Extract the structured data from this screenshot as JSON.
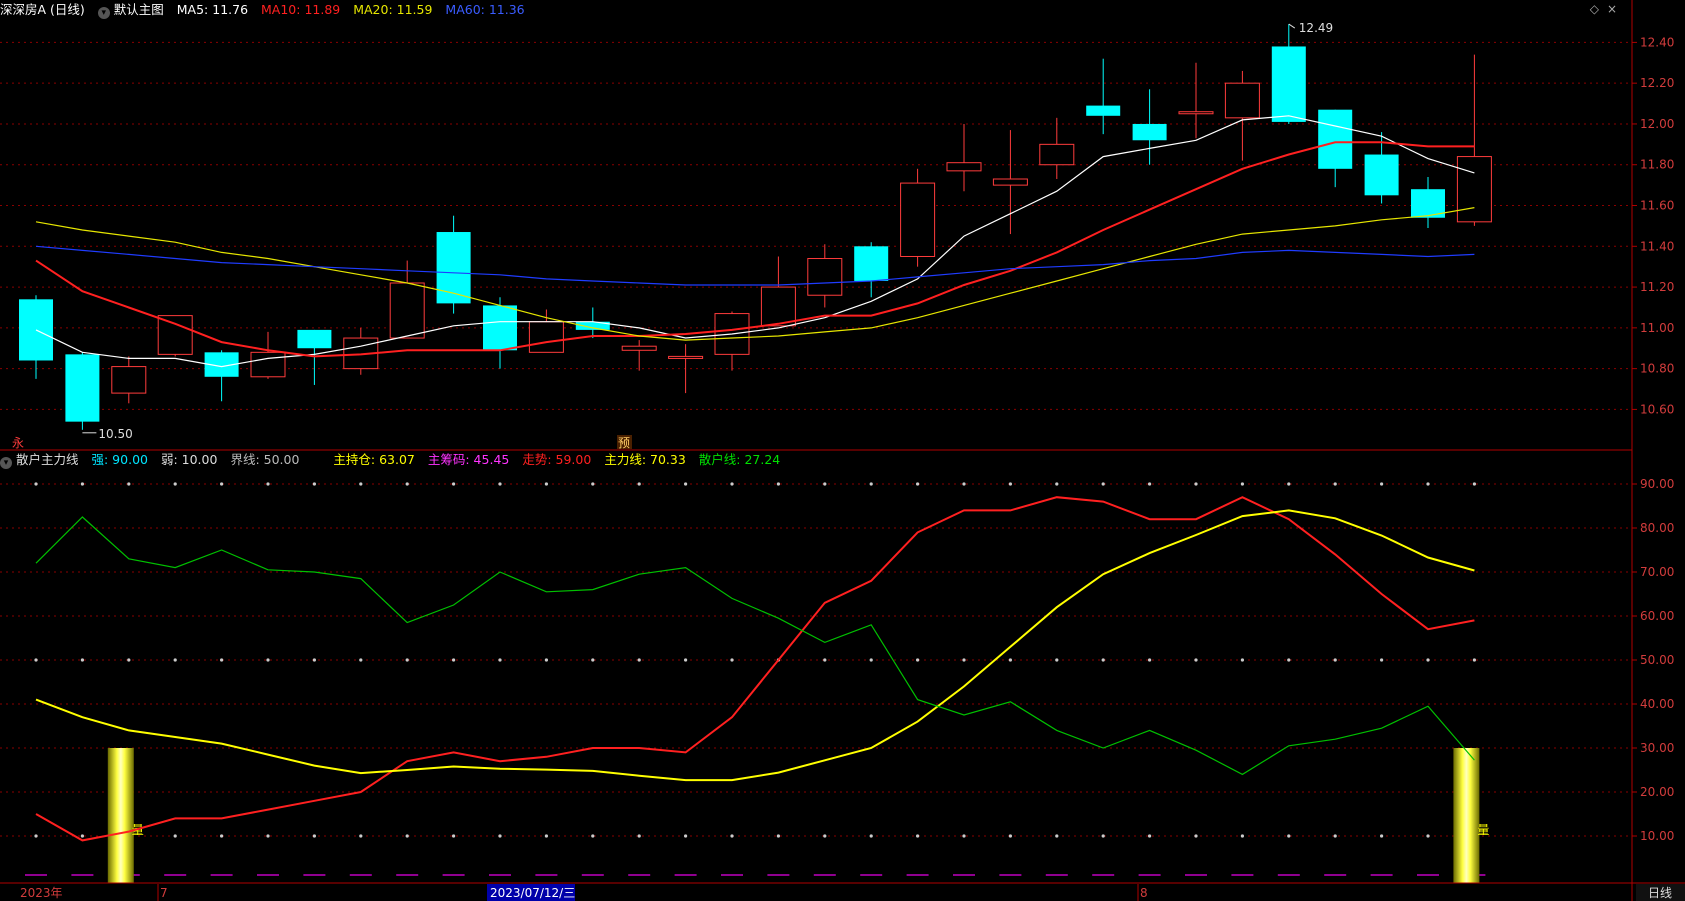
{
  "header": {
    "stock_name": "深深房A (日线)",
    "chart_mode": "默认主图",
    "ma5": "MA5: 11.76",
    "ma10": "MA10: 11.89",
    "ma20": "MA20: 11.59",
    "ma60": "MA60: 11.36"
  },
  "indicator_header": {
    "name": "散户主力线",
    "strong": "强: 90.00",
    "weak": "弱: 10.00",
    "boundary": "界线: 50.00",
    "main_hold": "主持仓: 63.07",
    "main_chips": "主筹码: 45.45",
    "trend": "走势: 59.00",
    "main_line": "主力线: 70.33",
    "retail_line": "散户线: 27.24"
  },
  "annotations": {
    "high_label": "12.49",
    "low_label": "10.50",
    "marker_left": "永",
    "marker_mid": "预",
    "bar_label": "量"
  },
  "x_axis": {
    "labels": [
      "2023年",
      "7",
      "2023/07/12/三",
      "8"
    ],
    "period": "日线"
  },
  "colors": {
    "up": "#ff3c3c",
    "down": "#00ffff",
    "ma5": "#ffffff",
    "ma10": "#ff2020",
    "ma20": "#e6e600",
    "ma60": "#1f3cff",
    "trend": "#ff2020",
    "main_line": "#ffff00",
    "retail_line": "#00c000",
    "grid": "#8a0000",
    "axis_text": "#d23c3c"
  },
  "chart_data": [
    {
      "type": "candlestick",
      "title": "深深房A (日线)",
      "ylim": [
        10.45,
        12.5
      ],
      "yticks": [
        10.6,
        10.8,
        11.0,
        11.2,
        11.4,
        11.6,
        11.8,
        12.0,
        12.2,
        12.4
      ],
      "ytick_labels": [
        "10.60",
        "10.80",
        "11.00",
        "11.20",
        "11.40",
        "11.60",
        "11.80",
        "12.00",
        "12.20",
        "12.40"
      ],
      "candles": [
        {
          "o": 11.14,
          "h": 11.16,
          "l": 10.75,
          "c": 10.84
        },
        {
          "o": 10.87,
          "h": 10.88,
          "l": 10.5,
          "c": 10.54
        },
        {
          "o": 10.68,
          "h": 10.86,
          "l": 10.63,
          "c": 10.81
        },
        {
          "o": 10.87,
          "h": 11.06,
          "l": 10.86,
          "c": 11.06
        },
        {
          "o": 10.88,
          "h": 10.89,
          "l": 10.64,
          "c": 10.76
        },
        {
          "o": 10.76,
          "h": 10.98,
          "l": 10.75,
          "c": 10.88
        },
        {
          "o": 10.99,
          "h": 10.99,
          "l": 10.72,
          "c": 10.9
        },
        {
          "o": 10.8,
          "h": 11.0,
          "l": 10.77,
          "c": 10.95
        },
        {
          "o": 10.95,
          "h": 11.33,
          "l": 10.95,
          "c": 11.22
        },
        {
          "o": 11.47,
          "h": 11.55,
          "l": 11.07,
          "c": 11.12
        },
        {
          "o": 11.11,
          "h": 11.15,
          "l": 10.8,
          "c": 10.89
        },
        {
          "o": 10.88,
          "h": 11.09,
          "l": 10.88,
          "c": 11.03
        },
        {
          "o": 11.03,
          "h": 11.1,
          "l": 10.95,
          "c": 10.99
        },
        {
          "o": 10.89,
          "h": 10.94,
          "l": 10.79,
          "c": 10.91
        },
        {
          "o": 10.85,
          "h": 10.92,
          "l": 10.68,
          "c": 10.86
        },
        {
          "o": 10.87,
          "h": 11.08,
          "l": 10.79,
          "c": 11.07
        },
        {
          "o": 11.01,
          "h": 11.35,
          "l": 11.01,
          "c": 11.2
        },
        {
          "o": 11.16,
          "h": 11.41,
          "l": 11.1,
          "c": 11.34
        },
        {
          "o": 11.4,
          "h": 11.42,
          "l": 11.15,
          "c": 11.23
        },
        {
          "o": 11.35,
          "h": 11.78,
          "l": 11.3,
          "c": 11.71
        },
        {
          "o": 11.77,
          "h": 12.0,
          "l": 11.67,
          "c": 11.81
        },
        {
          "o": 11.7,
          "h": 11.97,
          "l": 11.46,
          "c": 11.73
        },
        {
          "o": 11.8,
          "h": 12.03,
          "l": 11.73,
          "c": 11.9
        },
        {
          "o": 12.09,
          "h": 12.32,
          "l": 11.95,
          "c": 12.04
        },
        {
          "o": 12.0,
          "h": 12.17,
          "l": 11.8,
          "c": 11.92
        },
        {
          "o": 12.05,
          "h": 12.3,
          "l": 11.93,
          "c": 12.06
        },
        {
          "o": 12.03,
          "h": 12.26,
          "l": 11.82,
          "c": 12.2
        },
        {
          "o": 12.38,
          "h": 12.49,
          "l": 12.0,
          "c": 12.01
        },
        {
          "o": 12.07,
          "h": 12.07,
          "l": 11.69,
          "c": 11.78
        },
        {
          "o": 11.85,
          "h": 11.96,
          "l": 11.61,
          "c": 11.65
        },
        {
          "o": 11.68,
          "h": 11.74,
          "l": 11.49,
          "c": 11.54
        },
        {
          "o": 11.52,
          "h": 12.34,
          "l": 11.5,
          "c": 11.84
        }
      ],
      "series": [
        {
          "name": "MA5",
          "values": [
            10.99,
            10.88,
            10.85,
            10.85,
            10.81,
            10.85,
            10.87,
            10.91,
            10.96,
            11.01,
            11.03,
            11.03,
            11.03,
            11.0,
            10.95,
            10.97,
            11.0,
            11.05,
            11.13,
            11.24,
            11.45,
            11.56,
            11.67,
            11.84,
            11.88,
            11.92,
            12.02,
            12.04,
            11.99,
            11.94,
            11.83,
            11.76
          ]
        },
        {
          "name": "MA10",
          "values": [
            11.33,
            11.18,
            11.1,
            11.02,
            10.93,
            10.89,
            10.86,
            10.87,
            10.89,
            10.89,
            10.89,
            10.93,
            10.96,
            10.96,
            10.97,
            10.99,
            11.02,
            11.06,
            11.06,
            11.12,
            11.21,
            11.28,
            11.37,
            11.48,
            11.58,
            11.68,
            11.78,
            11.85,
            11.91,
            11.91,
            11.89,
            11.89
          ]
        },
        {
          "name": "MA20",
          "values": [
            11.52,
            11.48,
            11.45,
            11.42,
            11.37,
            11.34,
            11.3,
            11.26,
            11.22,
            11.17,
            11.11,
            11.05,
            11.0,
            10.96,
            10.94,
            10.95,
            10.96,
            10.98,
            11.0,
            11.05,
            11.11,
            11.17,
            11.23,
            11.29,
            11.35,
            11.41,
            11.46,
            11.48,
            11.5,
            11.53,
            11.55,
            11.59
          ]
        },
        {
          "name": "MA60",
          "values": [
            11.4,
            11.38,
            11.36,
            11.34,
            11.32,
            11.31,
            11.3,
            11.29,
            11.28,
            11.27,
            11.26,
            11.24,
            11.23,
            11.22,
            11.21,
            11.21,
            11.21,
            11.22,
            11.23,
            11.25,
            11.27,
            11.29,
            11.3,
            11.31,
            11.33,
            11.34,
            11.37,
            11.38,
            11.37,
            11.36,
            11.35,
            11.36
          ]
        }
      ]
    },
    {
      "type": "line",
      "title": "散户主力线",
      "ylim": [
        0,
        95
      ],
      "yticks": [
        10,
        20,
        30,
        40,
        50,
        60,
        70,
        80,
        90
      ],
      "ytick_labels": [
        "10.00",
        "20.00",
        "30.00",
        "40.00",
        "50.00",
        "60.00",
        "70.00",
        "80.00",
        "90.00"
      ],
      "reference_lines": [
        10,
        50,
        90
      ],
      "series": [
        {
          "name": "走势",
          "values": [
            15,
            9,
            11,
            14,
            14,
            16,
            18,
            20,
            27,
            29,
            27,
            28,
            30,
            30,
            29,
            37,
            50,
            63,
            68,
            79,
            84,
            84,
            87,
            86,
            82,
            82,
            87,
            82,
            74,
            65,
            57,
            59
          ]
        },
        {
          "name": "主力线",
          "values": [
            41,
            37,
            34,
            32.5,
            31,
            28.5,
            26,
            24.3,
            25,
            25.8,
            25.3,
            25.1,
            24.8,
            23.7,
            22.7,
            22.7,
            24.4,
            27.2,
            30,
            36,
            44,
            53,
            62,
            69.5,
            74.3,
            78.4,
            82.7,
            84,
            82.2,
            78.3,
            73.3,
            70.33
          ]
        },
        {
          "name": "散户线",
          "values": [
            72,
            82.5,
            73,
            71,
            75,
            70.5,
            70,
            68.5,
            58.5,
            62.5,
            70,
            65.5,
            66,
            69.5,
            71,
            64,
            59.5,
            54,
            58,
            41,
            37.5,
            40.5,
            34,
            30,
            34,
            29.5,
            24,
            30.5,
            32,
            34.5,
            39.5,
            27.24
          ]
        }
      ],
      "volume_bars": [
        {
          "index": 2,
          "value": 30
        },
        {
          "index": 31,
          "value": 30
        }
      ]
    }
  ]
}
